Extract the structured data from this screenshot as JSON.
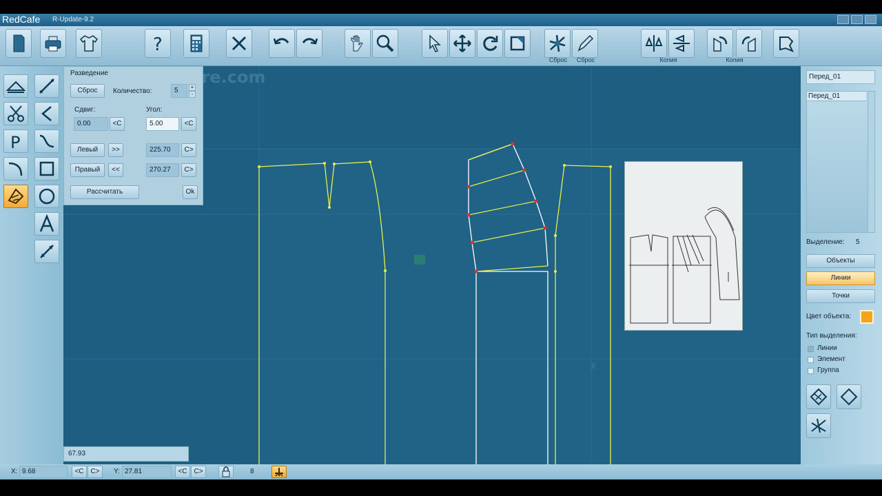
{
  "app": {
    "name": "RedCafe",
    "version": "R-Update-9.2"
  },
  "toolbar": {
    "captions": {
      "reset1": "Сброс",
      "reset2": "Сброс",
      "copy1": "Копия",
      "copy2": "Копия"
    }
  },
  "watermark": "RedCafeScore.com",
  "dialog": {
    "title": "Разведение",
    "reset_label": "Сброс",
    "count_label": "Количество:",
    "count_value": "5",
    "shift_label": "Сдвиг:",
    "shift_value": "0.00",
    "angle_label": "Угол:",
    "angle_value": "5.00",
    "back_btn": "<C",
    "fwd_btn": "C>",
    "left_label": "Левый",
    "left_arrow": ">>",
    "left_value": "225.70",
    "right_label": "Правый",
    "right_arrow": "<<",
    "right_value": "270.27",
    "calc_label": "Рассчитать",
    "ok_label": "Ok"
  },
  "right_panel": {
    "name_value": "Перед_01",
    "list_items": [
      "Перед_01"
    ],
    "selection_label": "Выделение:",
    "selection_count": "5",
    "btn_objects": "Объекты",
    "btn_lines": "Линии",
    "btn_points": "Точки",
    "color_label": "Цвет объекта:",
    "object_color": "#f2a41a",
    "select_type_label": "Тип выделения:",
    "select_types": [
      "Линии",
      "Элемент",
      "Группа"
    ]
  },
  "length_value": "67.93",
  "status": {
    "x_label": "X:",
    "x_value": "9.68",
    "y_label": "Y:",
    "y_value": "27.81",
    "back": "<C",
    "fwd": "C>",
    "snap_value": "8"
  },
  "colors": {
    "canvas_bg": "#1e5e80",
    "pattern_line": "#e8f04a",
    "selected_line": "#ffffff",
    "point": "#e03030",
    "active_tool": "#f3a936"
  }
}
